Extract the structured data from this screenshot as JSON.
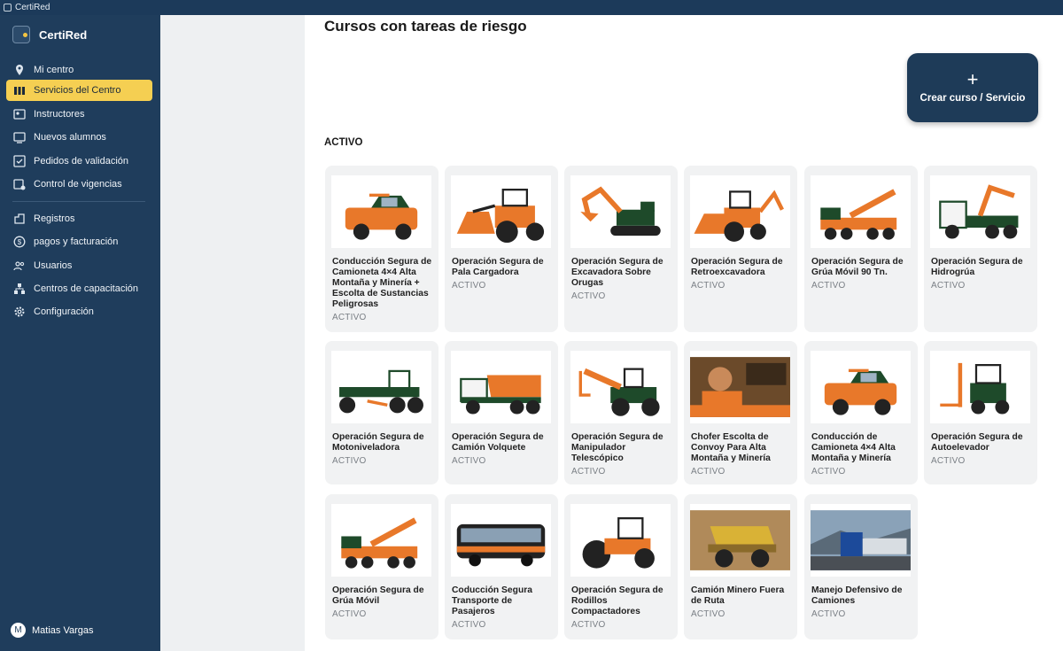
{
  "window": {
    "title": "CertiRed"
  },
  "sidebar": {
    "brand": "CertiRed",
    "items": [
      {
        "label": "Mi centro",
        "icon": "location-pin-icon"
      },
      {
        "label": "Servicios del Centro",
        "icon": "services-icon",
        "active": true
      },
      {
        "label": "Instructores",
        "icon": "instructor-icon"
      },
      {
        "label": "Nuevos alumnos",
        "icon": "new-students-icon"
      },
      {
        "label": "Pedidos de validación",
        "icon": "validation-icon"
      },
      {
        "label": "Control de vigencias",
        "icon": "calendar-check-icon"
      },
      {
        "label": "Registros",
        "icon": "records-icon"
      },
      {
        "label": "pagos y facturación",
        "icon": "dollar-icon"
      },
      {
        "label": "Usuarios",
        "icon": "users-icon"
      },
      {
        "label": "Centros de capacitación",
        "icon": "org-icon"
      },
      {
        "label": "Configuración",
        "icon": "gear-icon"
      }
    ],
    "user": {
      "initial": "M",
      "name": "Matias Vargas"
    }
  },
  "main": {
    "title": "Cursos con tareas de riesgo",
    "create_button": "Crear curso / Servicio",
    "section": "ACTIVO",
    "courses": [
      {
        "title": "Conducción Segura de Camioneta 4×4 Alta Montaña y Minería + Escolta de Sustancias Peligrosas",
        "status": "ACTIVO",
        "image": "pickup-truck"
      },
      {
        "title": "Operación Segura de Pala Cargadora",
        "status": "ACTIVO",
        "image": "wheel-loader"
      },
      {
        "title": "Operación Segura de Excavadora Sobre Orugas",
        "status": "ACTIVO",
        "image": "excavator"
      },
      {
        "title": "Operación Segura de Retroexcavadora",
        "status": "ACTIVO",
        "image": "backhoe"
      },
      {
        "title": "Operación Segura de Grúa Móvil 90 Tn.",
        "status": "ACTIVO",
        "image": "mobile-crane"
      },
      {
        "title": "Operación Segura de Hidrogrúa",
        "status": "ACTIVO",
        "image": "hydro-crane"
      },
      {
        "title": "Operación Segura de Motoniveladora",
        "status": "ACTIVO",
        "image": "motor-grader"
      },
      {
        "title": "Operación Segura de Camión Volquete",
        "status": "ACTIVO",
        "image": "dump-truck"
      },
      {
        "title": "Operación Segura de Manipulador Telescópico",
        "status": "ACTIVO",
        "image": "telehandler"
      },
      {
        "title": "Chofer Escolta de Convoy Para Alta Montaña y Minería",
        "status": "ACTIVO",
        "image": "convoy-driver"
      },
      {
        "title": "Conducción de Camioneta 4×4 Alta Montaña y Minería",
        "status": "ACTIVO",
        "image": "pickup-truck"
      },
      {
        "title": "Operación Segura de Autoelevador",
        "status": "ACTIVO",
        "image": "forklift"
      },
      {
        "title": "Operación Segura de Grúa Móvil",
        "status": "ACTIVO",
        "image": "mobile-crane"
      },
      {
        "title": "Coducción Segura Transporte de Pasajeros",
        "status": "ACTIVO",
        "image": "bus"
      },
      {
        "title": "Operación Segura de Rodillos Compactadores",
        "status": "ACTIVO",
        "image": "roller"
      },
      {
        "title": "Camión Minero Fuera de Ruta",
        "status": "ACTIVO",
        "image": "mining-truck"
      },
      {
        "title": "Manejo Defensivo de Camiones",
        "status": "ACTIVO",
        "image": "highway-truck"
      }
    ]
  },
  "colors": {
    "sidebar": "#1f3d5c",
    "active": "#f5cf52",
    "button": "#1e3b58",
    "card": "#f1f2f3",
    "machine": "#e8782a"
  }
}
